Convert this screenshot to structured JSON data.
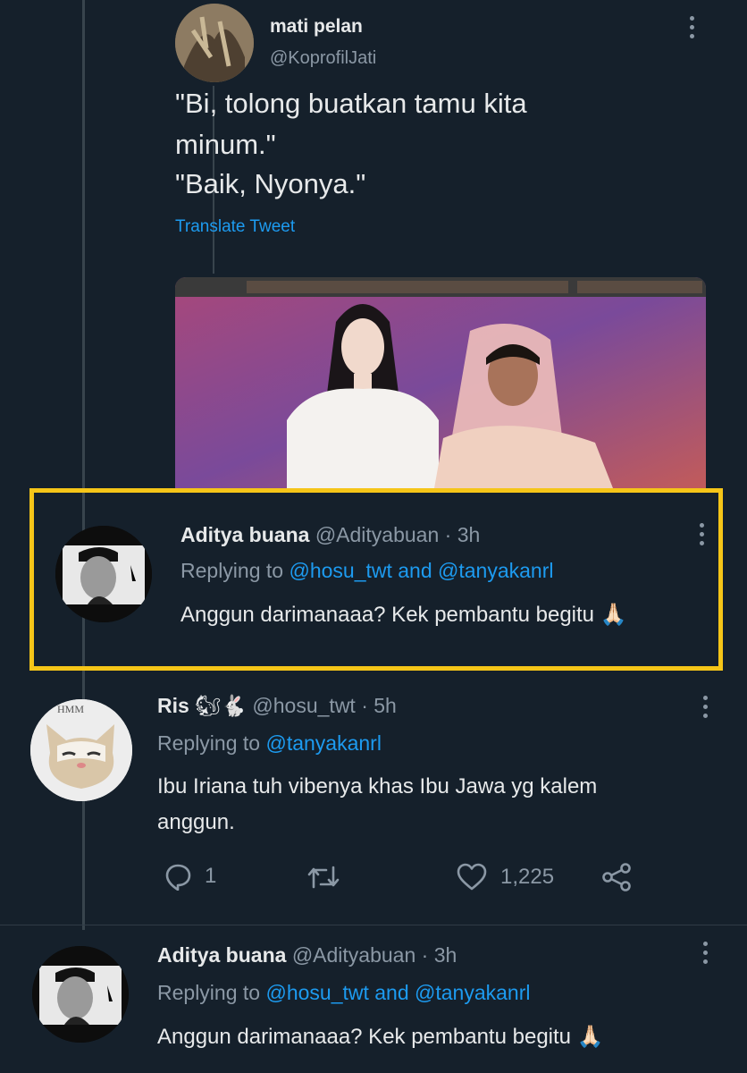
{
  "top_tweet": {
    "display_name": "mati pelan",
    "handle": "@KoprofilJati",
    "text_lines": [
      "\"Bi, tolong buatkan tamu kita",
      "minum.\"",
      "\"Baik, Nyonya.\""
    ],
    "translate_label": "Translate Tweet"
  },
  "highlighted_reply": {
    "display_name": "Aditya buana",
    "handle_time": "@Adityabuan · 3h",
    "replying_prefix": "Replying to",
    "replying_to": "@hosu_twt and @tanyakanrl",
    "text": "Anggun darimanaaa? Kek pembantu begitu 🙏🏻"
  },
  "ris_reply": {
    "display_name": "Ris",
    "name_emoji": "🐿🐇",
    "handle_time": "@hosu_twt · 5h",
    "replying_prefix": "Replying to",
    "replying_to": "@tanyakanrl",
    "text_lines": [
      "Ibu Iriana tuh vibenya khas Ibu Jawa yg kalem",
      "anggun."
    ],
    "avatar_watermark": "HMM",
    "actions": {
      "replies": "1",
      "retweets": "",
      "likes": "1,225"
    }
  },
  "bottom_reply": {
    "display_name": "Aditya buana",
    "handle_time": "@Adityabuan · 3h",
    "replying_prefix": "Replying to",
    "replying_to": "@hosu_twt and @tanyakanrl",
    "text": "Anggun darimanaaa? Kek pembantu begitu 🙏🏻"
  },
  "colors": {
    "background": "#15202b",
    "link": "#1d9bf0",
    "muted": "#8b98a5",
    "highlight_border": "#f5c518"
  },
  "icons": [
    "reply-icon",
    "retweet-icon",
    "like-icon",
    "share-icon",
    "more-options-icon"
  ]
}
